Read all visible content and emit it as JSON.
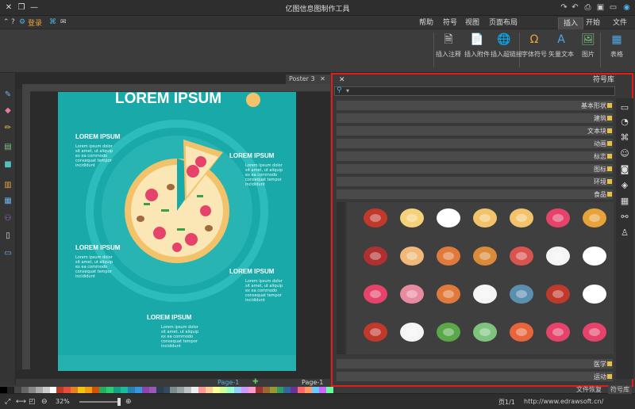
{
  "window": {
    "title": "亿图信息图制作工具",
    "controls": [
      "minimize",
      "maximize",
      "close"
    ]
  },
  "quick_access": [
    "new-icon",
    "open-icon",
    "save-icon",
    "print-icon",
    "undo-icon",
    "redo-icon"
  ],
  "menu": {
    "tabs": [
      "文件",
      "开始",
      "插入",
      "页面布局",
      "视图",
      "符号",
      "帮助"
    ],
    "active_tab": "插入",
    "login_label": "登录"
  },
  "ribbon": {
    "buttons": [
      {
        "label": "表格",
        "icon": "table-icon"
      },
      {
        "label": "图片",
        "icon": "image-icon"
      },
      {
        "label": "矢量文本",
        "icon": "vector-text-icon"
      },
      {
        "label": "字体符号",
        "icon": "font-symbol-icon"
      },
      {
        "label": "插入超链接",
        "icon": "hyperlink-icon"
      },
      {
        "label": "插入附件",
        "icon": "attachment-icon"
      },
      {
        "label": "插入注释",
        "icon": "comment-icon"
      }
    ]
  },
  "document": {
    "tab_label": "Poster 3",
    "poster": {
      "title": "LOREM IPSUM",
      "blocks": [
        {
          "heading": "LOREM IPSUM",
          "text": "Lorem ipsum dolor sit amet, ut aliquip ex ea commodo consequat tempor incididunt"
        },
        {
          "heading": "LOREM IPSUM",
          "text": "Lorem ipsum dolor sit amet, ut aliquip ex ea commodo consequat tempor incididunt"
        },
        {
          "heading": "LOREM IPSUM",
          "text": "Lorem ipsum dolor sit amet, ut aliquip ex ea commodo consequat tempor incididunt"
        },
        {
          "heading": "LOREM IPSUM",
          "text": "Lorem ipsum dolor sit amet, ut aliquip ex ea commodo consequat tempor incididunt"
        },
        {
          "heading": "LOREM IPSUM",
          "text": "Lorem ipsum dolor sit amet, ut aliquip ex ea commodo consequat tempor incididunt"
        }
      ]
    },
    "page_tabs": [
      "Page-1",
      "Page-1"
    ]
  },
  "symbol_library": {
    "title": "符号库",
    "categories": [
      "基本形状",
      "建筑",
      "文本块",
      "动画",
      "标志",
      "图标",
      "环境",
      "食品"
    ],
    "bottom_categories": [
      "医学",
      "运动"
    ],
    "food_symbols": [
      "hamburger",
      "hotdog",
      "pizza",
      "pizza-slice",
      "plate-cutlery",
      "fried-egg-plate",
      "sushi-box",
      "sushi-set",
      "sushi-rolls",
      "sausage",
      "roast-chicken",
      "ham",
      "chicken-leg",
      "steak",
      "fried-egg",
      "crab",
      "fish",
      "radish-white",
      "shrimp",
      "octopus",
      "tomato",
      "radish",
      "tomato-slices",
      "carrot",
      "bok-choy",
      "broccoli",
      "turnip",
      "cherries"
    ]
  },
  "status": {
    "zoom": "32%",
    "page_indicator": "页1/1",
    "url": "http://www.edrawsoft.cn/",
    "tabs": [
      "符号库",
      "文件恢复"
    ]
  },
  "colors": {
    "accent_red": "#e31b1b",
    "poster_teal": "#19a9a8",
    "strip": [
      "#000000",
      "#222222",
      "#444444",
      "#666666",
      "#888888",
      "#aaaaaa",
      "#cccccc",
      "#ffffff",
      "#c0392b",
      "#e74c3c",
      "#e67e22",
      "#f1c40f",
      "#f39c12",
      "#d35400",
      "#27ae60",
      "#2ecc71",
      "#16a085",
      "#1abc9c",
      "#2980b9",
      "#3498db",
      "#8e44ad",
      "#9b59b6",
      "#2c3e50",
      "#34495e",
      "#7f8c8d",
      "#95a5a6",
      "#bdc3c7",
      "#ecf0f1",
      "#ff9999",
      "#ffcc99",
      "#ffff99",
      "#ccff99",
      "#99ffcc",
      "#99ccff",
      "#cc99ff",
      "#ff99cc",
      "#993333",
      "#996633",
      "#999933",
      "#339966",
      "#336699",
      "#663399",
      "#ff6666",
      "#ff9966",
      "#66ccff",
      "#cc66ff",
      "#66ff99"
    ]
  }
}
